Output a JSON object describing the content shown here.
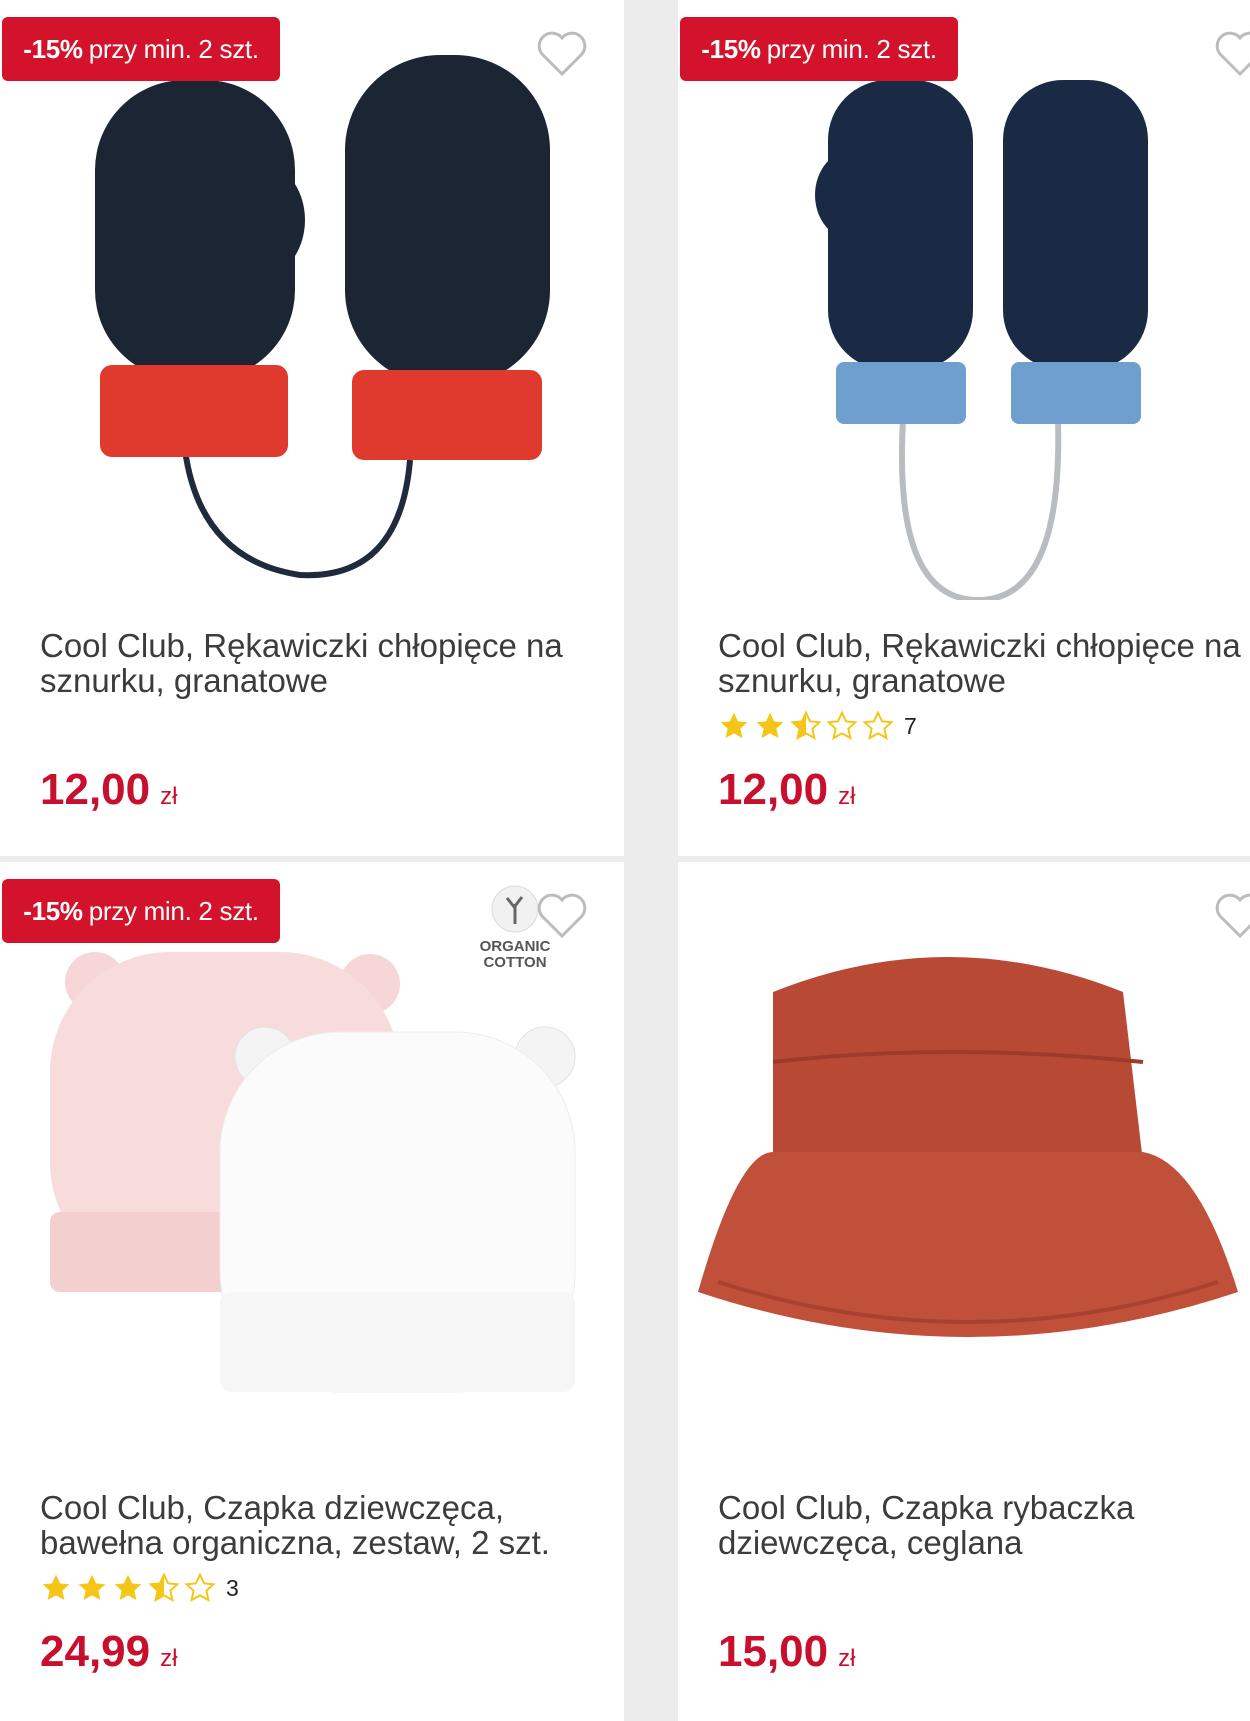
{
  "products": [
    {
      "badge_pct": "-15%",
      "badge_text": "przy min. 2 szt.",
      "title": "Cool Club, Rękawiczki chłopięce na sznurku, granatowe",
      "rating": null,
      "rating_count": "",
      "price": "12,00",
      "currency": "zł",
      "image": "navy-red-mittens"
    },
    {
      "badge_pct": "-15%",
      "badge_text": "przy min. 2 szt.",
      "title": "Cool Club, Rękawiczki chłopięce na sznurku, granatowe",
      "rating": 2.5,
      "rating_count": "7",
      "price": "12,00",
      "currency": "zł",
      "image": "navy-blue-mittens"
    },
    {
      "badge_pct": "-15%",
      "badge_text": "przy min. 2 szt.",
      "title": "Cool Club, Czapka dziewczęca, bawełna organiczna, zestaw, 2 szt.",
      "rating": 3.5,
      "rating_count": "3",
      "price": "24,99",
      "currency": "zł",
      "image": "pink-white-beanies",
      "organic_label": "ORGANIC COTTON"
    },
    {
      "badge_pct": "",
      "badge_text": "",
      "title": "Cool Club, Czapka rybaczka dziewczęca, ceglana",
      "rating": null,
      "rating_count": "",
      "price": "15,00",
      "currency": "zł",
      "image": "brick-bucket-hat"
    }
  ],
  "colors": {
    "badge": "#d3122b",
    "price": "#c8102e",
    "star": "#f5c518"
  },
  "icons": [
    "heart-icon",
    "star-icon"
  ]
}
